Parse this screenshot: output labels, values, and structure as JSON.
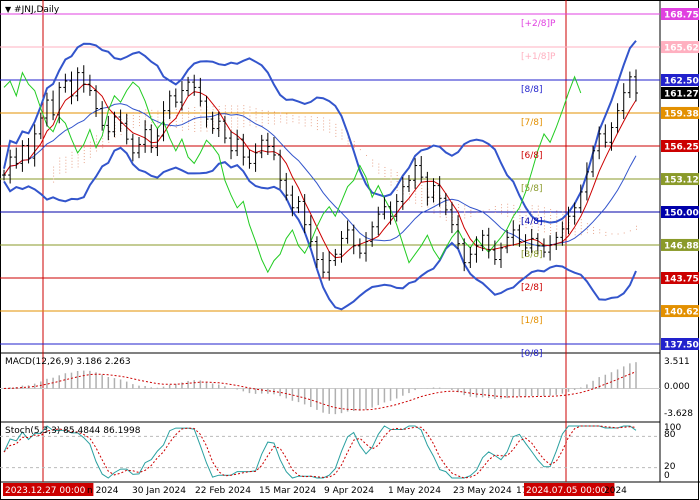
{
  "header": {
    "title": "#JNJ,Daily"
  },
  "colors": {
    "price_box": "#2222cc",
    "hline_red": "#cc0000",
    "hline_olive": "#8a9a2a",
    "hline_blue": "#0000aa",
    "hline_orange": "#e39000",
    "hline_pink": "#e040e0",
    "bollinger": "#3355cc",
    "ma": "#cc0000",
    "chikou": "#22cc22",
    "cloud": "#e8a890",
    "macd_hist": "#b0b0b0",
    "macd_signal": "#cc0000",
    "stoch_main": "#2aa0a0",
    "stoch_signal": "#cc0000",
    "marker": "#cc0000"
  },
  "chart_data": [
    {
      "type": "line",
      "title": "#JNJ,Daily",
      "ylim": [
        137.5,
        170.0
      ],
      "price_labels": [
        {
          "label": "168.75",
          "value": 168.75,
          "color": "#e040e0"
        },
        {
          "label": "165.62",
          "value": 165.62,
          "color": "#ffb0c0"
        },
        {
          "label": "162.50",
          "value": 162.5,
          "color": "#2222cc"
        },
        {
          "label": "161.27",
          "value": 161.27,
          "color": "#000000"
        },
        {
          "label": "159.38",
          "value": 159.38,
          "color": "#e39000"
        },
        {
          "label": "156.25",
          "value": 156.25,
          "color": "#cc0000"
        },
        {
          "label": "153.12",
          "value": 153.12,
          "color": "#8a9a2a"
        },
        {
          "label": "150.00",
          "value": 150.0,
          "color": "#0000aa"
        },
        {
          "label": "146.88",
          "value": 146.88,
          "color": "#8a9a2a"
        },
        {
          "label": "143.75",
          "value": 143.75,
          "color": "#cc0000"
        },
        {
          "label": "140.62",
          "value": 140.62,
          "color": "#e39000"
        },
        {
          "label": "137.50",
          "value": 137.5,
          "color": "#2222cc"
        }
      ],
      "murrey_levels": [
        {
          "label": "[+2/8]P",
          "value": 168.75,
          "color": "#e040e0"
        },
        {
          "label": "[+1/8]P",
          "value": 165.62,
          "color": "#ffb0c0"
        },
        {
          "label": "[8/8]",
          "value": 162.5,
          "color": "#2222cc"
        },
        {
          "label": "[7/8]",
          "value": 159.38,
          "color": "#e39000"
        },
        {
          "label": "[6/8]",
          "value": 156.25,
          "color": "#cc0000"
        },
        {
          "label": "[5/8]",
          "value": 153.12,
          "color": "#8a9a2a"
        },
        {
          "label": "[4/8]",
          "value": 150.0,
          "color": "#0000aa"
        },
        {
          "label": "[3/8]",
          "value": 146.88,
          "color": "#8a9a2a"
        },
        {
          "label": "[2/8]",
          "value": 143.75,
          "color": "#cc0000"
        },
        {
          "label": "[1/8]",
          "value": 140.62,
          "color": "#e39000"
        },
        {
          "label": "[0/8]",
          "value": 137.5,
          "color": "#2222cc"
        }
      ],
      "x_labels": [
        "2023.12.27 00:00",
        "n 2024",
        "30 Jan 2024",
        "22 Feb 2024",
        "15 Mar 2024",
        "9 Apr 2024",
        "1 May 2024",
        "23 May 2024",
        "17",
        "2024.07.05 00:00",
        "2024"
      ],
      "close": [
        153.5,
        155.2,
        154.6,
        156.3,
        155.1,
        157.4,
        158.9,
        160.6,
        159.2,
        161.8,
        162.4,
        161.0,
        163.2,
        162.1,
        161.5,
        159.8,
        158.2,
        157.6,
        159.0,
        158.4,
        156.9,
        155.6,
        156.4,
        157.8,
        156.1,
        157.2,
        159.6,
        161.0,
        160.4,
        161.5,
        162.3,
        161.8,
        160.5,
        158.8,
        157.9,
        158.6,
        157.0,
        155.8,
        156.9,
        155.2,
        154.6,
        155.6,
        156.8,
        156.2,
        155.4,
        153.0,
        151.6,
        150.4,
        151.0,
        148.8,
        147.2,
        145.5,
        144.3,
        145.4,
        146.0,
        147.5,
        148.3,
        146.8,
        146.1,
        147.2,
        148.6,
        149.8,
        150.5,
        149.6,
        151.0,
        152.4,
        153.0,
        154.4,
        153.3,
        151.4,
        152.5,
        151.3,
        150.2,
        148.8,
        147.0,
        145.2,
        146.0,
        146.8,
        147.8,
        146.4,
        145.5,
        146.6,
        147.6,
        148.3,
        147.2,
        146.6,
        147.5,
        146.8,
        146.2,
        146.9,
        147.6,
        148.4,
        149.6,
        150.4,
        151.9,
        153.8,
        155.8,
        157.4,
        156.6,
        158.0,
        159.6,
        161.3,
        162.8,
        161.27
      ],
      "series": [
        {
          "name": "Bollinger Bands"
        },
        {
          "name": "Moving Average"
        },
        {
          "name": "Ichimoku Chikou"
        }
      ]
    },
    {
      "type": "bar",
      "title": "MACD(12,26,9) 3.186 2.263",
      "ylim": [
        -3.628,
        3.511
      ],
      "tick_labels": [
        "3.511",
        "0.000",
        "-3.628"
      ],
      "main": 3.186,
      "signal": 2.263
    },
    {
      "type": "line",
      "title": "Stoch(5,3,3) 85.4844 86.1998",
      "ylim": [
        0,
        100
      ],
      "tick_labels": [
        "100",
        "80",
        "20",
        "0"
      ],
      "main": 85.4844,
      "signal": 86.1998
    }
  ]
}
